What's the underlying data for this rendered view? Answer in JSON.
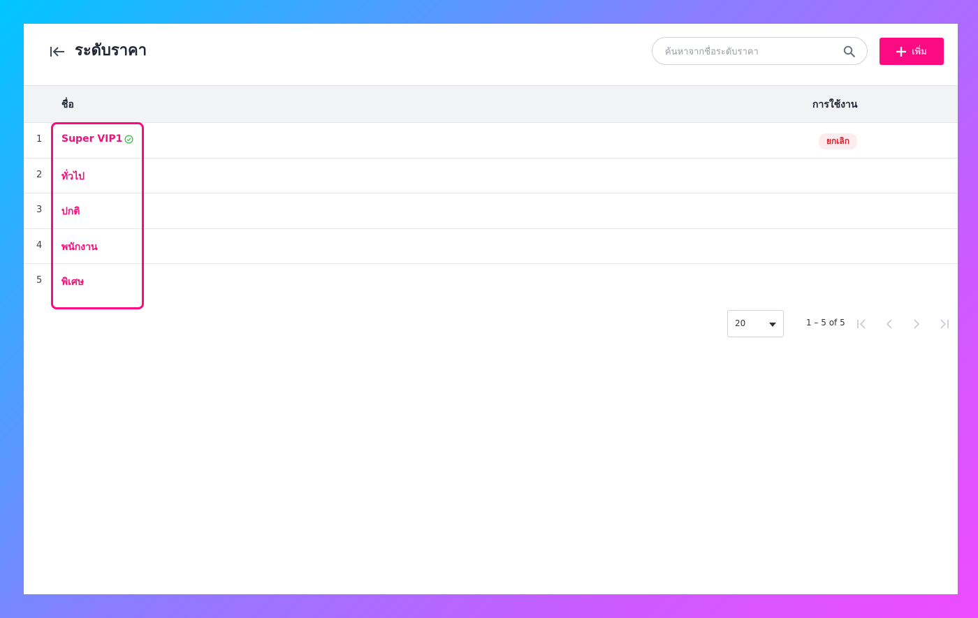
{
  "header": {
    "title": "ระดับราคา",
    "search_placeholder": "ค้นหาจากชื่อระดับราคา",
    "add_label": "เพิ่ม"
  },
  "table": {
    "columns": {
      "name": "ชื่อ",
      "status": "การใช้งาน"
    },
    "rows": [
      {
        "index": "1",
        "name": "Super VIP1",
        "verified": true,
        "status": "ยกเลิก"
      },
      {
        "index": "2",
        "name": "ทั่วไป",
        "verified": false,
        "status": ""
      },
      {
        "index": "3",
        "name": "ปกติ",
        "verified": false,
        "status": ""
      },
      {
        "index": "4",
        "name": "พนักงาน",
        "verified": false,
        "status": ""
      },
      {
        "index": "5",
        "name": "พิเศษ",
        "verified": false,
        "status": ""
      }
    ]
  },
  "pagination": {
    "page_size": "20",
    "range": "1 – 5 of 5"
  },
  "colors": {
    "accent": "#fb0a82",
    "link": "#f0107e",
    "status_cancel": "#e3202d",
    "verified": "#3bb54a"
  }
}
